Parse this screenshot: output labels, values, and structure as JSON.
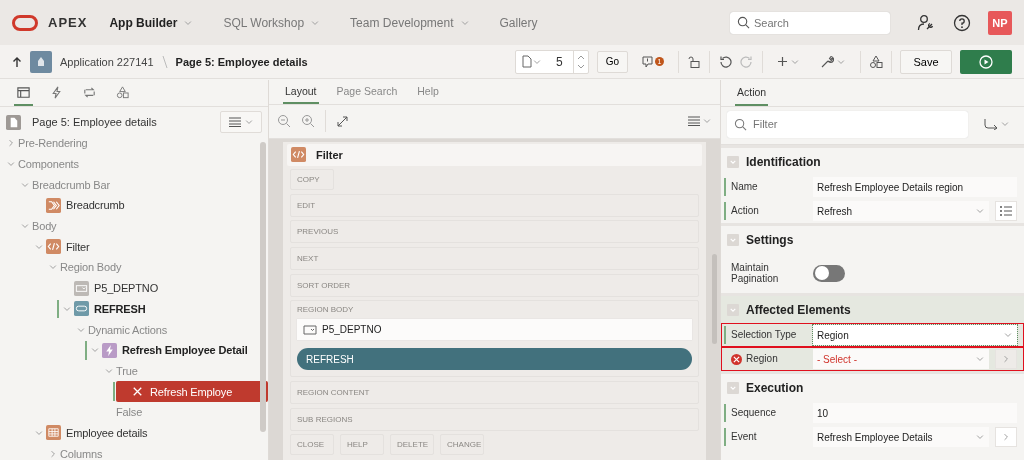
{
  "nav": {
    "logo": "APEX",
    "menus": [
      {
        "label": "App Builder",
        "selected": true,
        "dropdown": true
      },
      {
        "label": "SQL Workshop",
        "selected": false,
        "dropdown": true
      },
      {
        "label": "Team Development",
        "selected": false,
        "dropdown": true
      },
      {
        "label": "Gallery",
        "selected": false,
        "dropdown": false
      }
    ],
    "search_placeholder": "Search",
    "avatar": "NP"
  },
  "toolbar": {
    "application": "Application 227141",
    "page": "Page 5: Employee details",
    "page_number": "5",
    "go": "Go",
    "issue_count": "1",
    "save": "Save"
  },
  "tree_panel": {
    "tabs": [
      {
        "kind": "rendering",
        "selected": true
      },
      {
        "kind": "dynamic-actions",
        "selected": false
      },
      {
        "kind": "processing",
        "selected": false
      },
      {
        "kind": "shared",
        "selected": false
      }
    ],
    "page_title": "Page 5: Employee details",
    "nodes": [
      {
        "label": "Pre-Rendering",
        "expanded": false,
        "selected": false
      },
      {
        "label": "Components",
        "expanded": true,
        "selected": false,
        "children": [
          {
            "label": "Breadcrumb Bar",
            "expanded": true,
            "selected": false,
            "children": [
              {
                "label": "Breadcrumb",
                "kind": "breadcrumb",
                "selected": false
              }
            ]
          },
          {
            "label": "Body",
            "expanded": true,
            "selected": false,
            "children": [
              {
                "label": "Filter",
                "kind": "code",
                "expanded": true,
                "selected": false,
                "children": [
                  {
                    "label": "Region Body",
                    "expanded": true,
                    "selected": false,
                    "children": [
                      {
                        "label": "P5_DEPTNO",
                        "kind": "item",
                        "selected": false
                      },
                      {
                        "label": "REFRESH",
                        "kind": "button",
                        "expanded": true,
                        "bold": true,
                        "in_path": true,
                        "selected": false,
                        "children": [
                          {
                            "label": "Dynamic Actions",
                            "expanded": true,
                            "selected": false,
                            "children": [
                              {
                                "label": "Refresh Employee Detail",
                                "kind": "lightning",
                                "expanded": true,
                                "bold": true,
                                "in_path": true,
                                "selected": false,
                                "children": [
                                  {
                                    "label": "True",
                                    "expanded": true,
                                    "selected": false,
                                    "children": [
                                      {
                                        "label": "Refresh Employe",
                                        "kind": "error",
                                        "in_path": true,
                                        "selected": true
                                      }
                                    ]
                                  },
                                  {
                                    "label": "False",
                                    "selected": false
                                  }
                                ]
                              }
                            ]
                          }
                        ]
                      }
                    ]
                  }
                ]
              },
              {
                "label": "Employee details",
                "kind": "table",
                "expanded": true,
                "selected": false,
                "children": [
                  {
                    "label": "Columns",
                    "expanded": false,
                    "selected": false
                  }
                ]
              }
            ]
          }
        ]
      }
    ]
  },
  "layout_panel": {
    "tabs": [
      {
        "label": "Layout",
        "selected": true
      },
      {
        "label": "Page Search",
        "selected": false
      },
      {
        "label": "Help",
        "selected": false
      }
    ],
    "region_title": "Filter",
    "positions": [
      {
        "kind": "slots",
        "labels": [
          "COPY"
        ]
      },
      {
        "kind": "bar",
        "label": "EDIT"
      },
      {
        "kind": "bar",
        "label": "PREVIOUS"
      },
      {
        "kind": "bar",
        "label": "NEXT"
      },
      {
        "kind": "bar",
        "label": "SORT ORDER"
      },
      {
        "kind": "body",
        "label": "REGION BODY",
        "items": [
          {
            "kind": "item",
            "label": "P5_DEPTNO"
          },
          {
            "kind": "button",
            "label": "REFRESH"
          }
        ]
      },
      {
        "kind": "bar",
        "label": "REGION CONTENT"
      },
      {
        "kind": "bar",
        "label": "SUB REGIONS"
      },
      {
        "kind": "slots",
        "labels": [
          "CLOSE",
          "HELP",
          "DELETE",
          "CHANGE"
        ]
      }
    ]
  },
  "property_panel": {
    "tabs": [
      {
        "label": "Action",
        "selected": true
      }
    ],
    "filter_placeholder": "Filter",
    "groups": [
      {
        "title": "Identification",
        "current": false,
        "fields": [
          {
            "label": "Name",
            "kind": "text",
            "value": "Refresh Employee Details region",
            "error": false,
            "outlined": false
          },
          {
            "label": "Action",
            "kind": "select",
            "value": "Refresh",
            "side": {
              "kind": "list"
            },
            "error": false,
            "outlined": false
          }
        ]
      },
      {
        "title": "Settings",
        "current": false,
        "fields": [
          {
            "label": "Maintain Pagination",
            "kind": "switch",
            "on": false,
            "error": false,
            "outlined": false
          }
        ]
      },
      {
        "title": "Affected Elements",
        "current": true,
        "fields": [
          {
            "label": "Selection Type",
            "kind": "select",
            "value": "Region",
            "error": false,
            "outlined": true
          },
          {
            "label": "Region",
            "kind": "select",
            "value": "- Select -",
            "side": {
              "kind": "next"
            },
            "error": true,
            "outlined": true
          }
        ]
      },
      {
        "title": "Execution",
        "current": false,
        "fields": [
          {
            "label": "Sequence",
            "kind": "text",
            "value": "10",
            "error": false,
            "outlined": false
          },
          {
            "label": "Event",
            "kind": "select",
            "value": "Refresh Employee Details",
            "side": {
              "kind": "next"
            },
            "error": false,
            "outlined": false
          }
        ]
      }
    ]
  }
}
